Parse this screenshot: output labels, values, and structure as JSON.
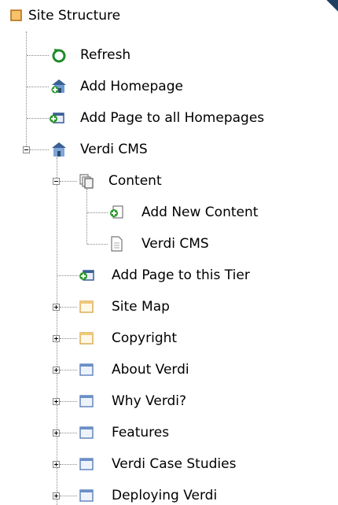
{
  "root": {
    "label": "Site Structure",
    "icon": "orange-square-icon"
  },
  "items": [
    {
      "label": "Refresh",
      "icon": "refresh-icon"
    },
    {
      "label": "Add Homepage",
      "icon": "add-homepage-icon"
    },
    {
      "label": "Add Page to all Homepages",
      "icon": "add-page-icon"
    },
    {
      "label": "Verdi CMS",
      "icon": "homepage-icon"
    },
    {
      "label": "Content",
      "icon": "content-pages-icon"
    },
    {
      "label": "Add New Content",
      "icon": "add-content-icon"
    },
    {
      "label": "Verdi CMS",
      "icon": "document-icon"
    },
    {
      "label": "Add Page to this Tier",
      "icon": "add-page-icon"
    },
    {
      "label": "Site Map",
      "icon": "page-yellow-icon"
    },
    {
      "label": "Copyright",
      "icon": "page-yellow-icon"
    },
    {
      "label": "About Verdi",
      "icon": "page-blue-icon"
    },
    {
      "label": "Why Verdi?",
      "icon": "page-blue-icon"
    },
    {
      "label": "Features",
      "icon": "page-blue-icon"
    },
    {
      "label": "Verdi Case Studies",
      "icon": "page-blue-icon"
    },
    {
      "label": "Deploying Verdi",
      "icon": "page-blue-icon"
    }
  ],
  "colors": {
    "tree_line": "#888888",
    "page_yellow": "#f0c878",
    "page_blue": "#6a8fc8",
    "add_green": "#2e9a2e"
  }
}
